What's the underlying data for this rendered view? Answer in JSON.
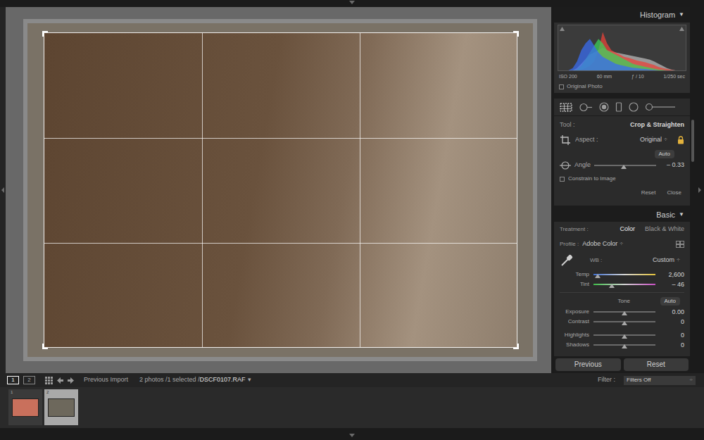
{
  "right_panel": {
    "histogram": {
      "title": "Histogram",
      "collapse": "▼",
      "series": [
        {
          "color": "#3a6cf0",
          "values": [
            0,
            5,
            20,
            45,
            60,
            70,
            55,
            40,
            30,
            25,
            20,
            15,
            12,
            10,
            8,
            6,
            5,
            4,
            3,
            2,
            1,
            0,
            0,
            0,
            0,
            0
          ]
        },
        {
          "color": "#3ccf5a",
          "values": [
            0,
            0,
            2,
            10,
            25,
            40,
            55,
            70,
            60,
            45,
            40,
            35,
            30,
            25,
            20,
            15,
            12,
            10,
            8,
            6,
            4,
            2,
            1,
            0,
            0,
            0
          ]
        },
        {
          "color": "#e8433a",
          "values": [
            0,
            0,
            0,
            2,
            5,
            10,
            20,
            45,
            85,
            60,
            45,
            40,
            35,
            30,
            28,
            25,
            22,
            20,
            18,
            15,
            12,
            8,
            5,
            3,
            1,
            0
          ]
        },
        {
          "color": "#b8b8b8",
          "values": [
            0,
            0,
            5,
            15,
            25,
            35,
            40,
            45,
            50,
            45,
            42,
            40,
            38,
            36,
            34,
            32,
            30,
            28,
            26,
            24,
            20,
            15,
            10,
            5,
            2,
            0
          ]
        }
      ],
      "info": [
        "ISO 200",
        "60 mm",
        "ƒ / 10",
        "1/250 sec"
      ],
      "original_photo": {
        "label": "Original Photo",
        "checked": false
      }
    },
    "tools": [
      {
        "kind": "crop",
        "selected": true
      },
      {
        "kind": "spot",
        "selected": false
      },
      {
        "kind": "redeye",
        "selected": false
      },
      {
        "kind": "graduated",
        "selected": false
      },
      {
        "kind": "radial",
        "selected": false
      },
      {
        "kind": "brush",
        "selected": false
      }
    ],
    "crop": {
      "tool_label": "Tool :",
      "tool": "Crop & Straighten",
      "aspect_label": "Aspect :",
      "aspect": "Original",
      "aspect_arrow": "÷",
      "locked": true,
      "auto": "Auto",
      "angle": {
        "label": "Angle",
        "level": 0.48,
        "reading": "– 0.33"
      },
      "constrain": {
        "label": "Constrain to Image",
        "checked": false
      },
      "buttons": [
        "Reset",
        "Close"
      ]
    },
    "basic": {
      "title": "Basic",
      "collapse": "▼",
      "treatment": {
        "label": "Treatment :",
        "options": [
          {
            "label": "Color",
            "selected": true
          },
          {
            "label": "Black & White",
            "selected": false
          }
        ]
      },
      "profile": {
        "label": "Profile :",
        "value": "Adobe Color",
        "arrow": "÷"
      },
      "wb": {
        "label": "WB :",
        "value": "Custom",
        "arrow": "÷"
      },
      "wb_sliders": [
        {
          "label": "Temp",
          "level": 0.07,
          "reading": "2,600",
          "kind": "temp"
        },
        {
          "label": "Tint",
          "level": 0.3,
          "reading": "– 46",
          "kind": "tint"
        }
      ],
      "tone": {
        "label": "Tone",
        "auto": "Auto"
      },
      "tone_sliders": [
        {
          "label": "Exposure",
          "level": 0.5,
          "reading": "0.00"
        },
        {
          "label": "Contrast",
          "level": 0.5,
          "reading": "0"
        },
        {
          "label": "Highlights",
          "level": 0.5,
          "reading": "0"
        },
        {
          "label": "Shadows",
          "level": 0.5,
          "reading": "0"
        }
      ]
    },
    "buttons": [
      "Previous",
      "Reset"
    ]
  },
  "toolbar": {
    "views": [
      {
        "label": "1",
        "selected": true
      },
      {
        "label": "2",
        "selected": false
      }
    ],
    "source": "Previous Import",
    "count": "2 photos /1 selected /",
    "file": "DSCF0107.RAF",
    "file_arrow": "▾",
    "filter_label": "Filter :",
    "filter": "Filters Off",
    "filter_arrow": "÷"
  },
  "filmstrip": [
    {
      "number": "1",
      "selected": false,
      "color": "#c9705c"
    },
    {
      "number": "2",
      "selected": true,
      "color": "#6d685c"
    }
  ]
}
